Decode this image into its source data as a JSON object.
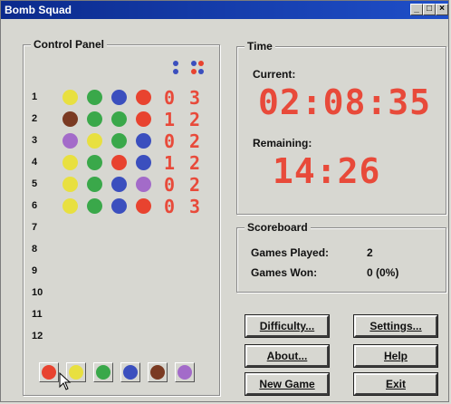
{
  "window": {
    "title": "Bomb Squad"
  },
  "control_panel": {
    "label": "Control Panel",
    "legend_icons": [
      "blue-dots-icon",
      "mixed-dots-icon"
    ],
    "rows": [
      {
        "num": "1",
        "colors": [
          "#e8e040",
          "#3aa84a",
          "#3b4fbe",
          "#e8432f"
        ],
        "correct_place": "0",
        "correct_color": "3"
      },
      {
        "num": "2",
        "colors": [
          "#7a3a22",
          "#3aa84a",
          "#3aa84a",
          "#e8432f"
        ],
        "correct_place": "1",
        "correct_color": "2"
      },
      {
        "num": "3",
        "colors": [
          "#a36bc9",
          "#e8e040",
          "#3aa84a",
          "#3b4fbe"
        ],
        "correct_place": "0",
        "correct_color": "2"
      },
      {
        "num": "4",
        "colors": [
          "#e8e040",
          "#3aa84a",
          "#e8432f",
          "#3b4fbe"
        ],
        "correct_place": "1",
        "correct_color": "2"
      },
      {
        "num": "5",
        "colors": [
          "#e8e040",
          "#3aa84a",
          "#3b4fbe",
          "#a36bc9"
        ],
        "correct_place": "0",
        "correct_color": "2"
      },
      {
        "num": "6",
        "colors": [
          "#e8e040",
          "#3aa84a",
          "#3b4fbe",
          "#e8432f"
        ],
        "correct_place": "0",
        "correct_color": "3"
      },
      {
        "num": "7"
      },
      {
        "num": "8"
      },
      {
        "num": "9"
      },
      {
        "num": "10"
      },
      {
        "num": "11"
      },
      {
        "num": "12"
      }
    ],
    "palette": [
      "#e8432f",
      "#e8e040",
      "#3aa84a",
      "#3b4fbe",
      "#7a3a22",
      "#a36bc9"
    ]
  },
  "time": {
    "label": "Time",
    "current_label": "Current:",
    "current_value": "02:08:35",
    "remaining_label": "Remaining:",
    "remaining_value": "14:26"
  },
  "scoreboard": {
    "label": "Scoreboard",
    "games_played_label": "Games Played:",
    "games_played_value": "2",
    "games_won_label": "Games Won:",
    "games_won_value": "0 (0%)"
  },
  "buttons": {
    "difficulty": "Difficulty...",
    "settings": "Settings...",
    "about": "About...",
    "help": "Help",
    "new_game": "New Game",
    "exit": "Exit"
  }
}
